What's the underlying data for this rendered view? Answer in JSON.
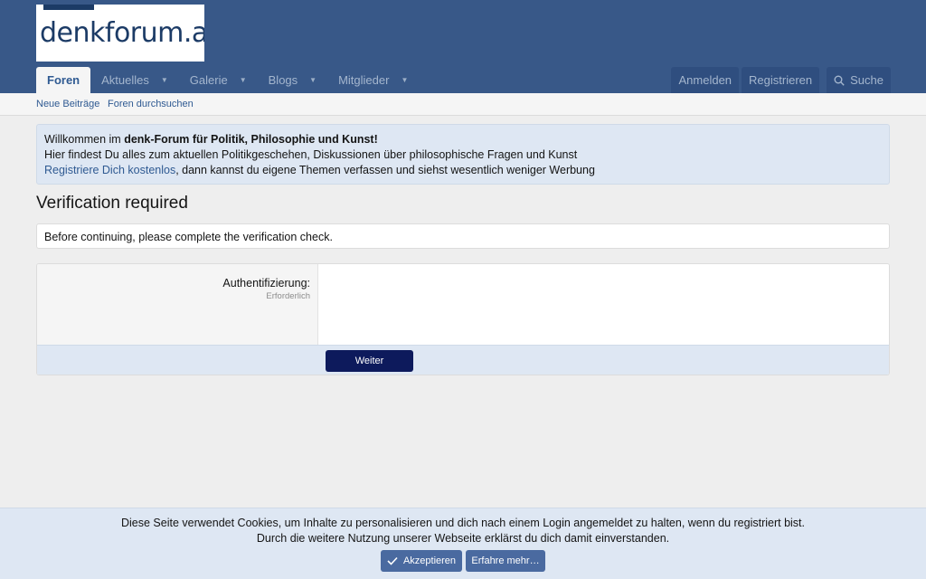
{
  "header": {
    "logo_text": "denkforum.at",
    "nav": {
      "tabs": [
        {
          "label": "Foren"
        },
        {
          "label": "Aktuelles"
        },
        {
          "label": "Galerie"
        },
        {
          "label": "Blogs"
        },
        {
          "label": "Mitglieder"
        }
      ],
      "login": "Anmelden",
      "register": "Registrieren",
      "search": "Suche"
    }
  },
  "subnav": {
    "links": [
      {
        "label": "Neue Beiträge"
      },
      {
        "label": "Foren durchsuchen"
      }
    ]
  },
  "notice": {
    "line1_prefix": "Willkommen im ",
    "line1_bold": "denk-Forum für Politik, Philosophie und Kunst!",
    "line2": "Hier findest Du alles zum aktuellen Politikgeschehen, Diskussionen über philosophische Fragen und Kunst",
    "line3_link": "Registriere Dich kostenlos",
    "line3_rest": ", dann kannst du eigene Themen verfassen und siehst wesentlich weniger Werbung"
  },
  "main": {
    "title": "Verification required",
    "message": "Before continuing, please complete the verification check.",
    "form": {
      "label": "Authentifizierung:",
      "hint": "Erforderlich",
      "submit": "Weiter"
    }
  },
  "cookie": {
    "line1": "Diese Seite verwendet Cookies, um Inhalte zu personalisieren und dich nach einem Login angemeldet zu halten, wenn du registriert bist.",
    "line2": "Durch die weitere Nutzung unserer Webseite erklärst du dich damit einverstanden.",
    "accept": "Akzeptieren",
    "learn_more": "Erfahre mehr…"
  },
  "colors": {
    "header_bg": "#385888",
    "accent": "#2f5a92",
    "primary_button": "#0d1a5c",
    "notice_bg": "#dee7f3"
  }
}
